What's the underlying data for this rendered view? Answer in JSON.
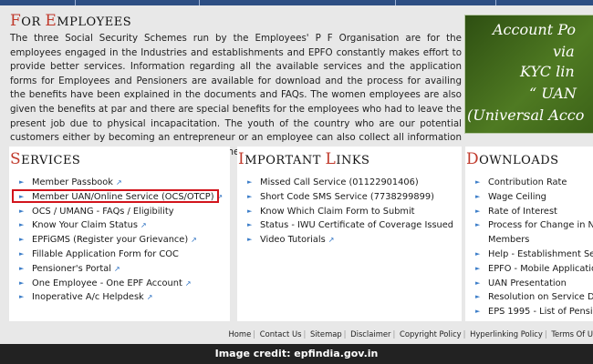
{
  "header": {
    "title_initial": "F",
    "title_rest": "OR ",
    "title_initial2": "E",
    "title_rest2": "MPLOYEES"
  },
  "intro_text": "The three Social Security Schemes run by the Employees' P F Organisation are for the employees engaged in the Industries and establishments and EPFO constantly makes effort to provide better services. Information regarding all the available services and the application forms for Employees and Pensioners are available for download and the process for availing the benefits have been explained in the documents and FAQs. The women employees are also given the benefits at par and there are special benefits for the employees who had to leave the present job due to physical incapacitation. The youth of the country who are our potential customers either by becoming an entrepreneur or an employee can also collect all information on the facilities and the benefits provided by the EPFO.",
  "banner": {
    "line1": "Account Po",
    "line2": "via",
    "line3": "KYC lin",
    "line4": "“ UAN",
    "line5": "(Universal Acco"
  },
  "services": {
    "heading_initial": "S",
    "heading_rest": "ERVICES",
    "items": [
      {
        "label": "Member Passbook"
      },
      {
        "label": "Member UAN/Online Service (OCS/OTCP)"
      },
      {
        "label": "OCS / UMANG - FAQs / Eligibility"
      },
      {
        "label": "Know Your Claim Status"
      },
      {
        "label": "EPFiGMS (Register your Grievance)"
      },
      {
        "label": "Fillable Application Form for COC"
      },
      {
        "label": "Pensioner's Portal"
      },
      {
        "label": "One Employee - One EPF Account"
      },
      {
        "label": "Inoperative A/c Helpdesk"
      }
    ]
  },
  "important_links": {
    "heading_initial": "I",
    "heading_rest": "MPORTANT ",
    "heading_initial2": "L",
    "heading_rest2": "INKS",
    "items": [
      {
        "label": "Missed Call Service (01122901406)"
      },
      {
        "label": "Short Code SMS Service (7738299899)"
      },
      {
        "label": "Know Which Claim Form to Submit"
      },
      {
        "label": "Status - IWU Certificate of Coverage Issued"
      },
      {
        "label": "Video Tutorials"
      }
    ]
  },
  "downloads": {
    "heading_initial": "D",
    "heading_rest": "OWNLOADS",
    "items": [
      {
        "label": "Contribution Rate"
      },
      {
        "label": "Wage Ceiling"
      },
      {
        "label": "Rate of Interest"
      },
      {
        "label": "Process for Change in Na"
      },
      {
        "label": "Members"
      },
      {
        "label": "Help - Establishment Sear"
      },
      {
        "label": "EPFO - Mobile Applicatio"
      },
      {
        "label": "UAN Presentation"
      },
      {
        "label": "Resolution on Service Del"
      },
      {
        "label": "EPS 1995 - List of Pensio"
      }
    ]
  },
  "footer": {
    "links": [
      "Home",
      "Contact Us",
      "Sitemap",
      "Disclaimer",
      "Copyright Policy",
      "Hyperlinking Policy",
      "Terms Of U"
    ]
  },
  "credit": "Image credit: epfindia.gov.in",
  "colors": {
    "accent_red": "#c0392b",
    "highlight_border": "#d2141c",
    "link_blue": "#2a6fc1",
    "topbar": "#2d4e83"
  }
}
